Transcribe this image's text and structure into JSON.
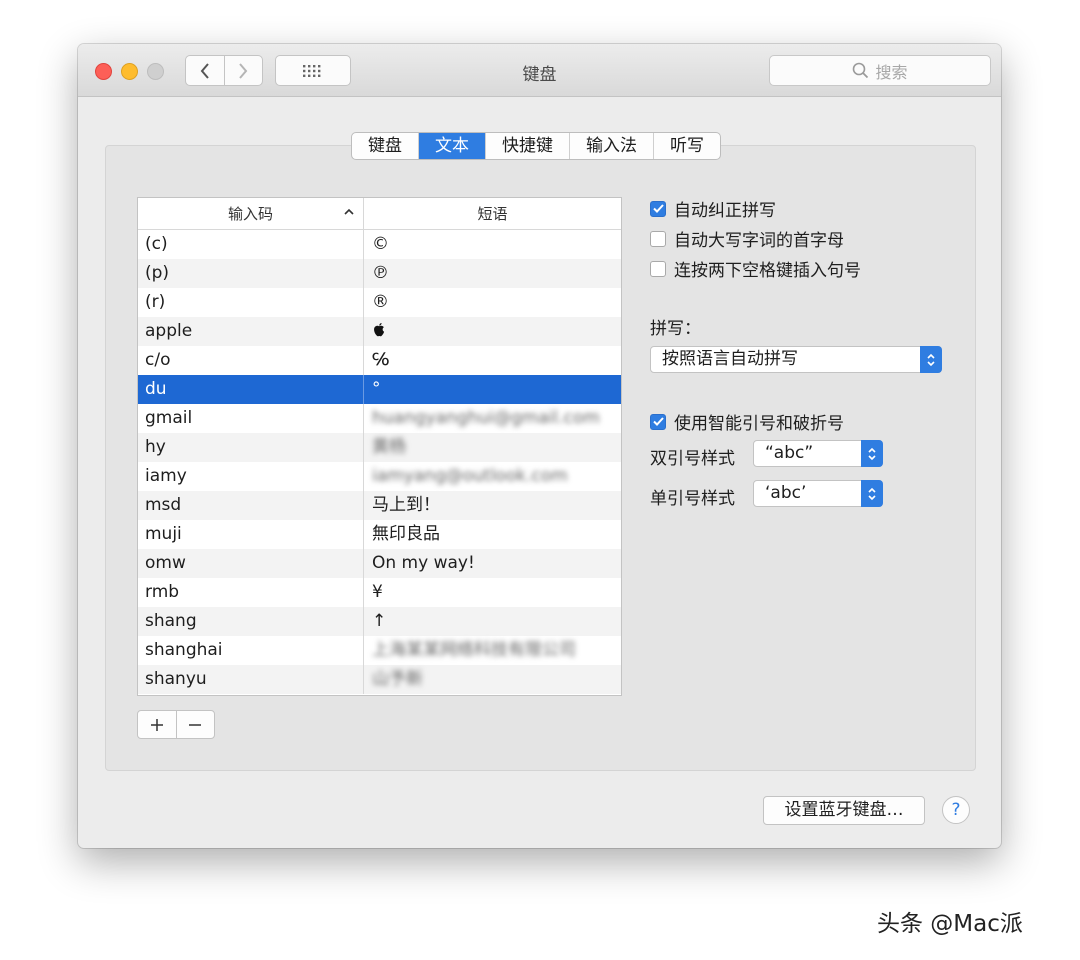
{
  "window": {
    "title": "键盘"
  },
  "search": {
    "placeholder": "搜索"
  },
  "tabs": [
    {
      "label": "键盘"
    },
    {
      "label": "文本",
      "active": true
    },
    {
      "label": "快捷键"
    },
    {
      "label": "输入法"
    },
    {
      "label": "听写"
    }
  ],
  "table": {
    "columns": [
      "输入码",
      "短语"
    ],
    "sort_icon": "chevron-up-icon",
    "selected_row": "du",
    "rows": [
      {
        "code": "(c)",
        "phrase": "©"
      },
      {
        "code": "(p)",
        "phrase": "℗"
      },
      {
        "code": "(r)",
        "phrase": "®"
      },
      {
        "code": "apple",
        "phrase": ""
      },
      {
        "code": "c/o",
        "phrase": "℅"
      },
      {
        "code": "du",
        "phrase": "°"
      },
      {
        "code": "gmail",
        "phrase": "huangyanghui@gmail.com"
      },
      {
        "code": "hy",
        "phrase": "黄杨"
      },
      {
        "code": "iamy",
        "phrase": "iamyang@outlook.com"
      },
      {
        "code": "msd",
        "phrase": "马上到！"
      },
      {
        "code": "muji",
        "phrase": "無印良品"
      },
      {
        "code": "omw",
        "phrase": "On my way!"
      },
      {
        "code": "rmb",
        "phrase": "¥"
      },
      {
        "code": "shang",
        "phrase": "↑"
      },
      {
        "code": "shanghai",
        "phrase": "上海某某网络科技有限公司"
      },
      {
        "code": "shanyu",
        "phrase": "山予新"
      }
    ]
  },
  "buttons": {
    "add": "+",
    "remove": "−",
    "bluetooth": "设置蓝牙键盘…",
    "help": "?"
  },
  "options": {
    "auto_correct": {
      "label": "自动纠正拼写",
      "checked": true
    },
    "auto_capitalize": {
      "label": "自动大写字词的首字母",
      "checked": false
    },
    "double_space_period": {
      "label": "连按两下空格键插入句号",
      "checked": false
    },
    "spelling_label": "拼写：",
    "spelling_value": "按照语言自动拼写",
    "smart_quotes": {
      "label": "使用智能引号和破折号",
      "checked": true
    },
    "double_quote_label": "双引号样式",
    "double_quote_value": "“abc”",
    "single_quote_label": "单引号样式",
    "single_quote_value": "‘abc’"
  },
  "watermark": "头条 @Mac派",
  "colors": {
    "accent": "#2f7de1",
    "selection": "#1e68d3",
    "close": "#fd5f57",
    "minimize": "#febc2e"
  }
}
